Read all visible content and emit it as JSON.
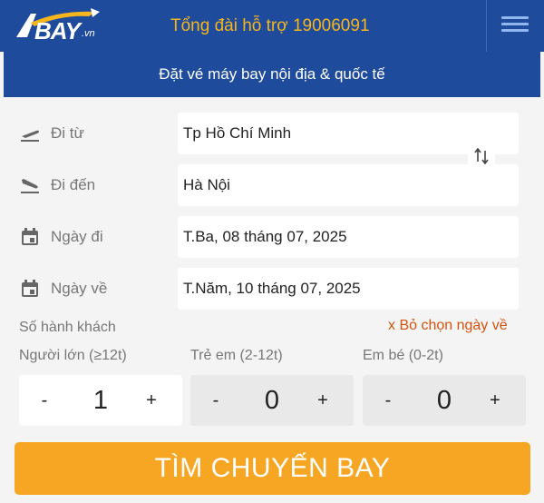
{
  "header": {
    "logo_text": "BAY",
    "logo_suffix": ".vn",
    "hotline": "Tổng đài hỗ trợ 19006091",
    "subtitle": "Đặt vé máy bay nội địa & quốc tế",
    "menu_icon": "hamburger-menu-icon"
  },
  "form": {
    "from": {
      "label": "Đi từ",
      "value": "Tp Hồ Chí Minh",
      "icon": "plane-takeoff-icon"
    },
    "to": {
      "label": "Đi đến",
      "value": "Hà Nội",
      "icon": "plane-landing-icon"
    },
    "depart": {
      "label": "Ngày đi",
      "value": "T.Ba, 08 tháng 07, 2025",
      "icon": "calendar-icon"
    },
    "return": {
      "label": "Ngày về",
      "value": "T.Năm, 10 tháng 07, 2025",
      "icon": "calendar-icon"
    },
    "swap_icon": "swap-vertical-icon"
  },
  "passengers": {
    "title": "Số hành khách",
    "clear_return": "x Bỏ chọn ngày về",
    "adult": {
      "label": "Người lớn (≥12t)",
      "value": "1"
    },
    "child": {
      "label": "Trẻ em (2-12t)",
      "value": "0"
    },
    "infant": {
      "label": "Em bé (0-2t)",
      "value": "0"
    },
    "minus": "-",
    "plus": "+"
  },
  "search_button": "TÌM CHUYẾN BAY",
  "colors": {
    "header_blue": "#1e4b9c",
    "hotline_yellow": "#f5b51d",
    "search_orange": "#f6a623",
    "clear_link": "#d4540d"
  }
}
